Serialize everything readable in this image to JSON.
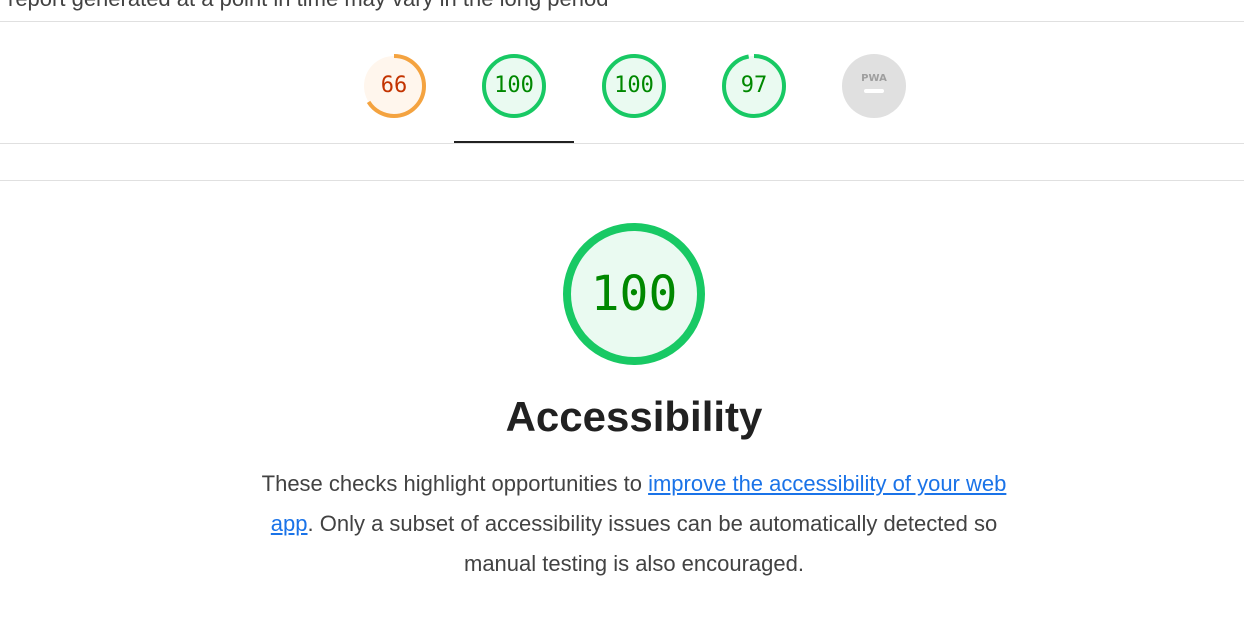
{
  "header": {
    "partial_text": "report generated at a point in time may vary in the long period"
  },
  "gauges": [
    {
      "name": "performance",
      "score": "66",
      "fraction": 0.66,
      "color": "#f4a340",
      "text_color": "#c33300",
      "fill": "#fff6ed"
    },
    {
      "name": "accessibility",
      "score": "100",
      "fraction": 1.0,
      "color": "#18c964",
      "text_color": "#008800",
      "fill": "#eafaf1"
    },
    {
      "name": "best-practices",
      "score": "100",
      "fraction": 1.0,
      "color": "#18c964",
      "text_color": "#008800",
      "fill": "#eafaf1"
    },
    {
      "name": "seo",
      "score": "97",
      "fraction": 0.97,
      "color": "#18c964",
      "text_color": "#008800",
      "fill": "#eafaf1"
    },
    {
      "name": "pwa",
      "badge": "PWA",
      "color": "#e0e0e0"
    }
  ],
  "selected_tab": "accessibility",
  "category": {
    "score": "100",
    "title": "Accessibility",
    "desc_before": "These checks highlight opportunities to ",
    "desc_link": "improve the accessibility of your web app",
    "desc_after": ". Only a subset of accessibility issues can be automatically detected so manual testing is also encouraged."
  }
}
